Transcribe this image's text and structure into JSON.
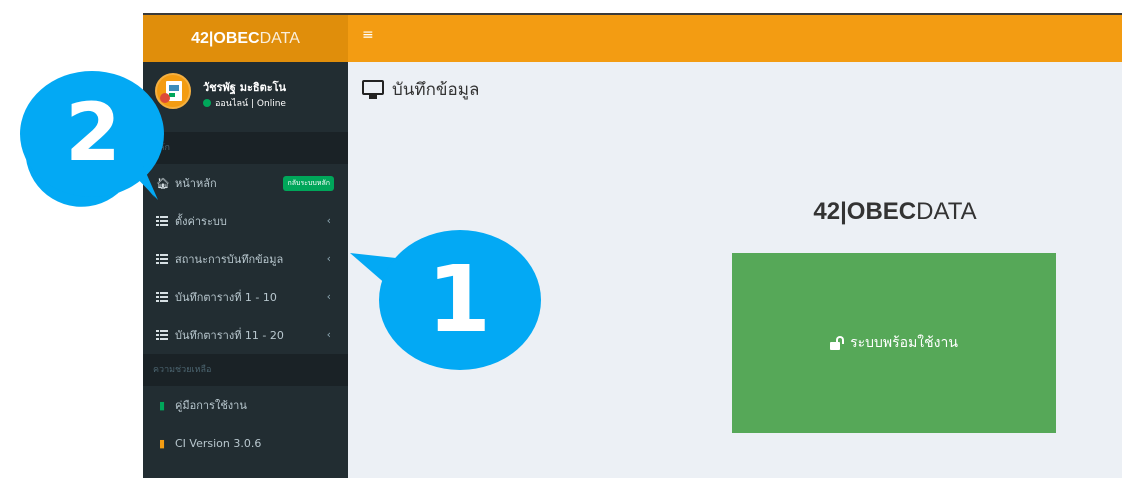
{
  "brand": {
    "bold": "42|OBEC",
    "light": "DATA"
  },
  "user": {
    "name": "วัชรพัฐ มะธิตะโน",
    "status": "ออนไลน์ | Online"
  },
  "menu": {
    "header_main": "หลัก",
    "header_help": "ความช่วยเหลือ",
    "items": [
      {
        "label": "หน้าหลัก",
        "icon": "home-icon",
        "badge": "กลับระบบหลัก"
      },
      {
        "label": "ตั้งค่าระบบ",
        "icon": "list-icon",
        "chevron": "‹"
      },
      {
        "label": "สถานะการบันทึกข้อมูล",
        "icon": "list-icon",
        "chevron": "‹"
      },
      {
        "label": "บันทึกตารางที่ 1 - 10",
        "icon": "list-icon",
        "chevron": "‹"
      },
      {
        "label": "บันทึกตารางที่ 11 - 20",
        "icon": "list-icon",
        "chevron": "‹"
      }
    ],
    "help_items": [
      {
        "label": "คู่มือการใช้งาน",
        "icon": "book-icon",
        "color": "#00a65a"
      },
      {
        "label": "CI Version 3.0.6",
        "icon": "book-icon",
        "color": "#f39c12"
      }
    ]
  },
  "navbar": {
    "toggle": "≡"
  },
  "page": {
    "title": "บันทึกข้อมูล",
    "brand_bold": "42|OBEC",
    "brand_light": "DATA",
    "status_text": "ระบบพร้อมใช้งาน"
  },
  "callouts": [
    {
      "number": "1",
      "color": "#03a9f4"
    },
    {
      "number": "2",
      "color": "#03a9f4"
    }
  ],
  "colors": {
    "navbar": "#f39c12",
    "logo": "#e08e0b",
    "sidebar": "#222d32",
    "success": "#56a858"
  }
}
